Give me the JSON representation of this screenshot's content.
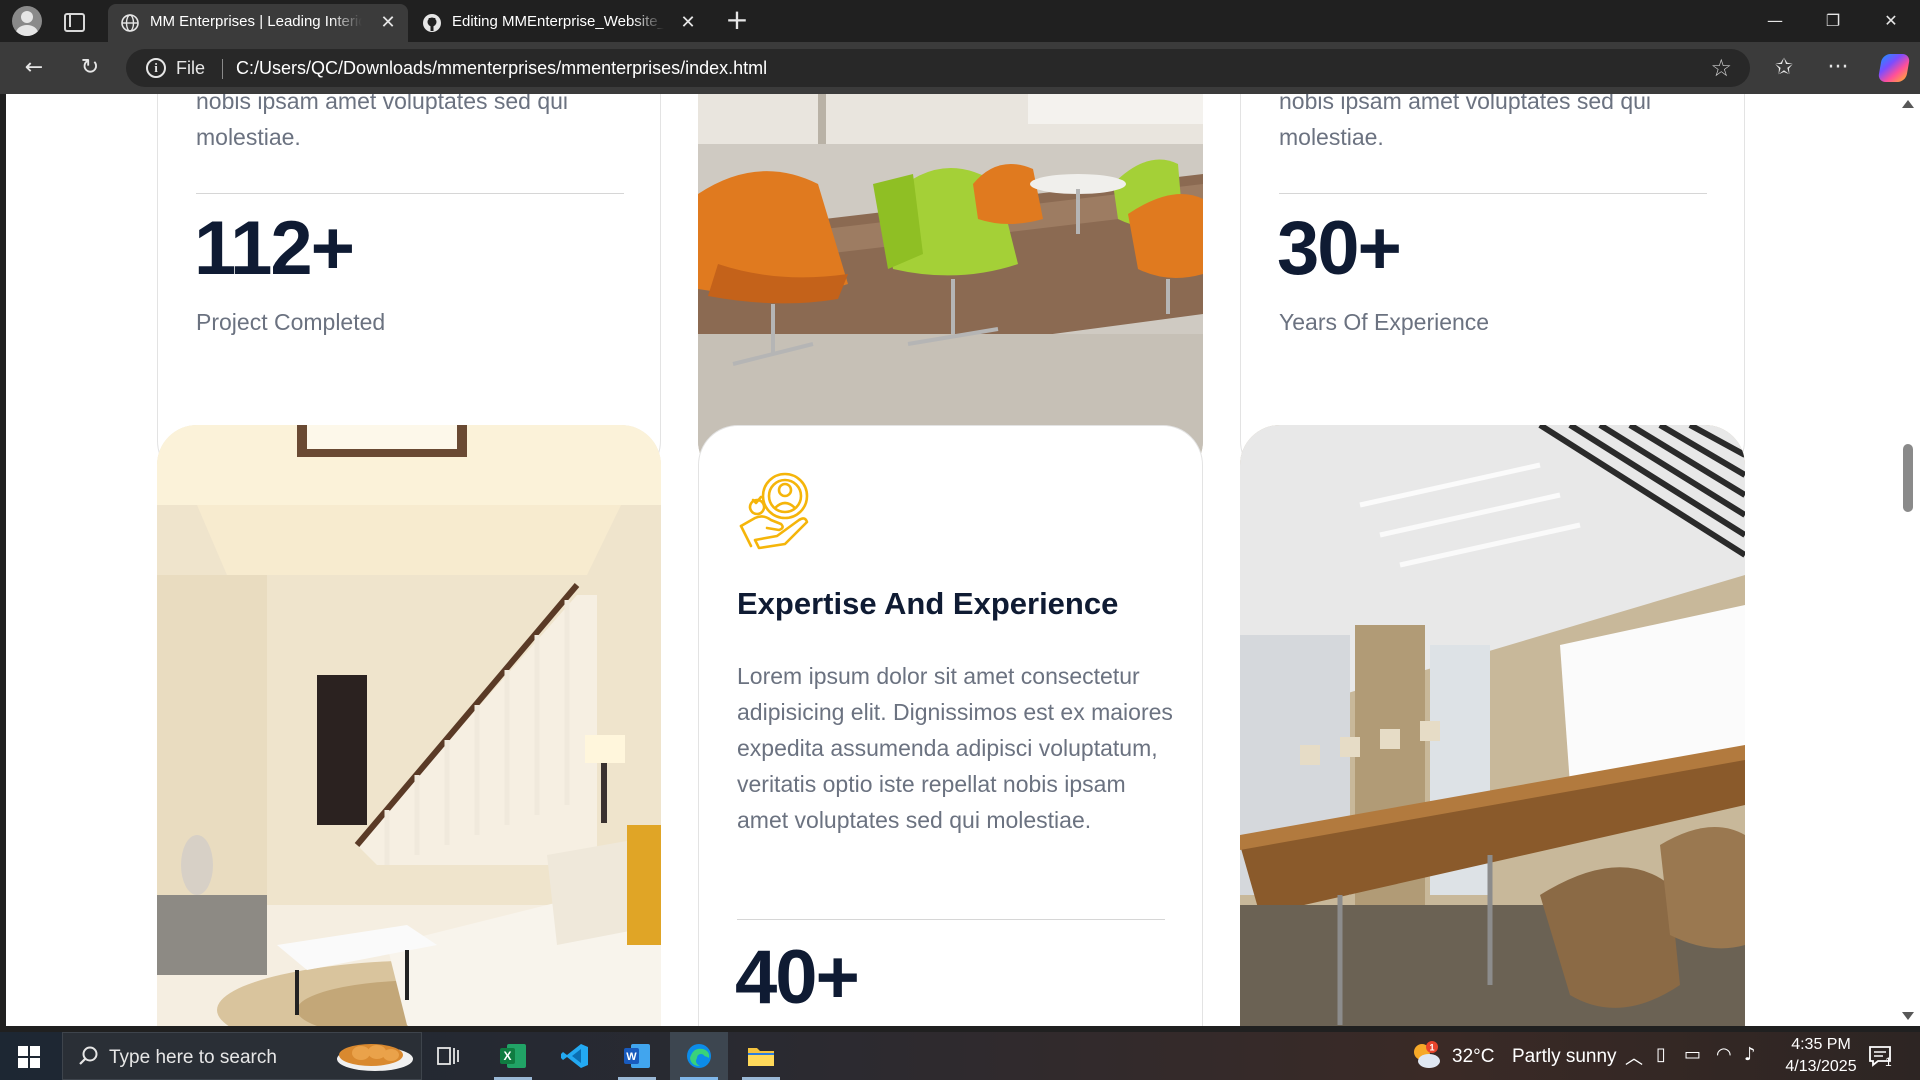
{
  "browser": {
    "tabs": [
      {
        "title": "MM Enterprises | Leading Interior",
        "icon": "globe-icon",
        "active": true
      },
      {
        "title": "Editing MMEnterprise_Website_pr",
        "icon": "github-icon",
        "active": false
      }
    ],
    "address_bar": {
      "scheme_label": "File",
      "url": "C:/Users/QC/Downloads/mmenterprises/mmenterprises/index.html"
    }
  },
  "page": {
    "cards": [
      {
        "description_tail": "nobis ipsam amet voluptates sed qui molestiae.",
        "stat_value": "112+",
        "stat_label": "Project Completed"
      },
      {
        "description_tail": "nobis ipsam amet voluptates sed qui molestiae.",
        "stat_value": "30+",
        "stat_label": "Years Of Experience"
      },
      {
        "icon": "expertise-hand-icon",
        "title": "Expertise And Experience",
        "description": "Lorem ipsum dolor sit amet consectetur adipisicing elit. Dignissimos est ex maiores expedita assumenda adipisci voluptatum, veritatis optio iste repellat nobis ipsam amet voluptates sed qui molestiae.",
        "stat_value": "40+"
      }
    ],
    "images": [
      {
        "name": "lounge-chairs-photo",
        "subject": "office lounge with orange and green chairs"
      },
      {
        "name": "living-room-photo",
        "subject": "living room with staircase"
      },
      {
        "name": "conference-room-photo",
        "subject": "conference room with long wooden table"
      }
    ],
    "accent_color": "#f5b50a",
    "heading_color": "#0f1b33"
  },
  "taskbar": {
    "search_placeholder": "Type here to search",
    "weather": {
      "temp": "32°C",
      "condition": "Partly sunny",
      "badge": "1"
    },
    "time": "4:35 PM",
    "date": "4/13/2025",
    "notifications": "1",
    "apps": [
      "task-view-icon",
      "excel-icon",
      "vscode-icon",
      "word-icon",
      "edge-icon",
      "file-explorer-icon"
    ]
  }
}
